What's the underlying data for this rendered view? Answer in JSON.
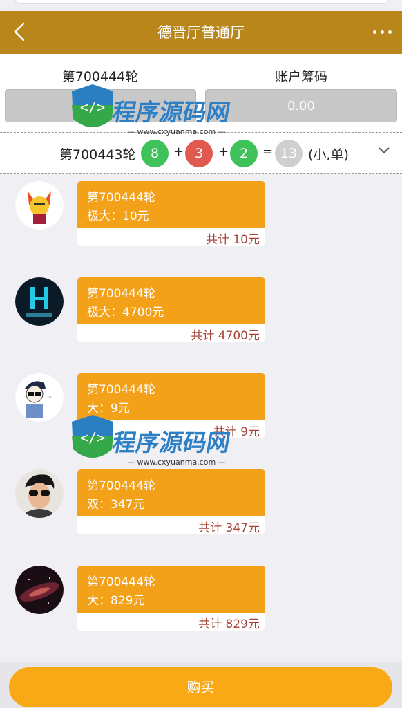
{
  "header": {
    "title": "德晋厅普通厅",
    "back_icon": "chevron-left-icon",
    "more_icon": "more-dots-icon"
  },
  "info": {
    "round_label": "第700444轮",
    "countdown_value": "",
    "chips_label": "账户筹码",
    "chips_value": "0.00"
  },
  "result": {
    "round": "第700443轮",
    "balls": [
      {
        "value": "8",
        "color": "#3fc25a"
      },
      {
        "value": "3",
        "color": "#e05a4f"
      },
      {
        "value": "2",
        "color": "#3fc25a"
      }
    ],
    "plus": "+",
    "equals": "=",
    "sum": {
      "value": "13",
      "color": "#cfcfcf"
    },
    "result_text": "(小,单)"
  },
  "feed": [
    {
      "round": "第700444轮",
      "bet": "极大：10元",
      "total": "共计 10元"
    },
    {
      "round": "第700444轮",
      "bet": "极大：4700元",
      "total": "共计 4700元"
    },
    {
      "round": "第700444轮",
      "bet": "大：9元",
      "total": "共计 9元"
    },
    {
      "round": "第700444轮",
      "bet": "双：347元",
      "total": "共计 347元"
    },
    {
      "round": "第700444轮",
      "bet": "大：829元",
      "total": "共计 829元"
    }
  ],
  "buy_button": "购买",
  "watermark": {
    "name": "程序源码网",
    "url": "www.cxyuanma.com"
  }
}
